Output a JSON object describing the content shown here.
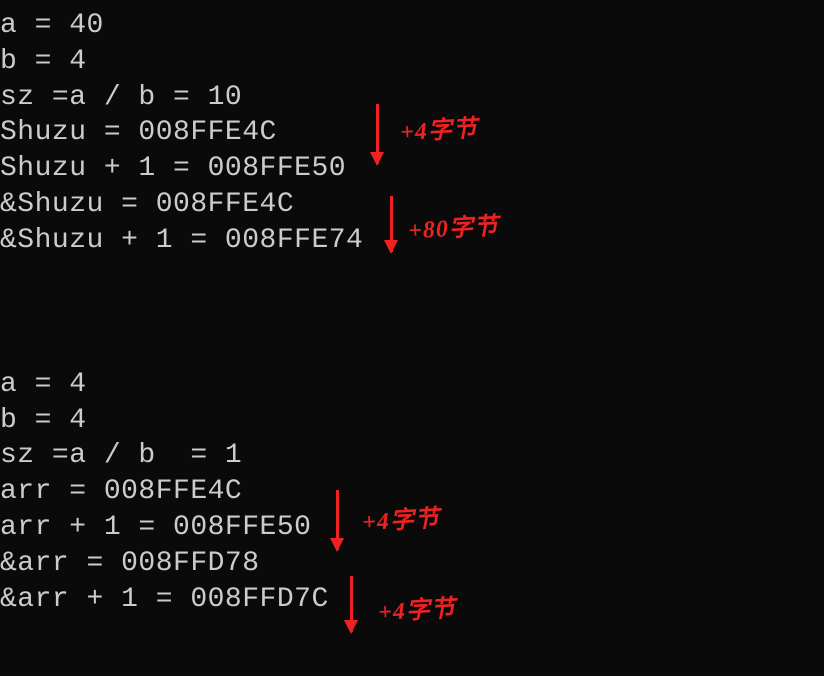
{
  "block1": {
    "line1": "a = 40",
    "line2": "b = 4",
    "line3": "sz =a / b = 10",
    "line4": "Shuzu = 008FFE4C",
    "line5": "Shuzu + 1 = 008FFE50",
    "line6": "&Shuzu = 008FFE4C",
    "line7": "&Shuzu + 1 = 008FFE74"
  },
  "block2": {
    "line1": "a = 4",
    "line2": "b = 4",
    "line3": "sz =a / b  = 1",
    "line4": "arr = 008FFE4C",
    "line5": "arr + 1 = 008FFE50",
    "line6": "&arr = 008FFD78",
    "line7": "&arr + 1 = 008FFD7C"
  },
  "annotations": {
    "a1": "+4字节",
    "a2": "+80字节",
    "a3": "+4字节",
    "a4": "+4字节"
  }
}
